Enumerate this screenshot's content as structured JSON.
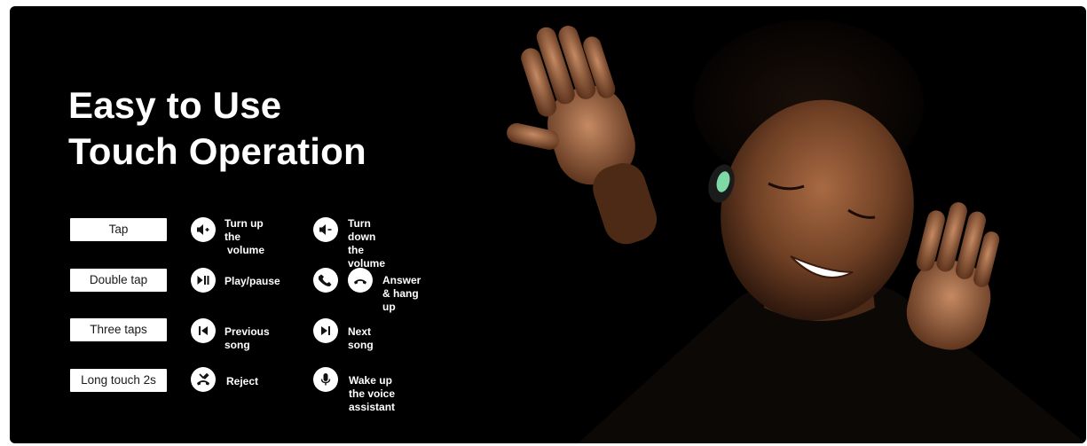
{
  "headline": {
    "line1": "Easy to Use",
    "line2": "Touch Operation"
  },
  "rows": [
    {
      "gesture": "Tap",
      "actions": [
        {
          "icon": "volume-up-icon",
          "label_line1": "Turn up the",
          "label_line2": "volume"
        },
        {
          "icon": "volume-down-icon",
          "label_line1": "Turn down the",
          "label_line2": "volume"
        }
      ]
    },
    {
      "gesture": "Double tap",
      "actions": [
        {
          "icon": "play-pause-icon",
          "label": "Play/pause"
        },
        {
          "icon": "phone-answer-icon",
          "icon2": "phone-hangup-icon",
          "label": "Answer & hang up"
        }
      ]
    },
    {
      "gesture": "Three taps",
      "actions": [
        {
          "icon": "previous-track-icon",
          "label": "Previous song"
        },
        {
          "icon": "next-track-icon",
          "label": "Next song"
        }
      ]
    },
    {
      "gesture": "Long touch 2s",
      "actions": [
        {
          "icon": "reject-call-icon",
          "label": "Reject"
        },
        {
          "icon": "microphone-icon",
          "label": "Wake up the voice assistant"
        }
      ]
    }
  ],
  "colors": {
    "background": "#000000",
    "text": "#ffffff",
    "chip": "#ffffff",
    "earbud_accent": "#7fd9a6"
  }
}
